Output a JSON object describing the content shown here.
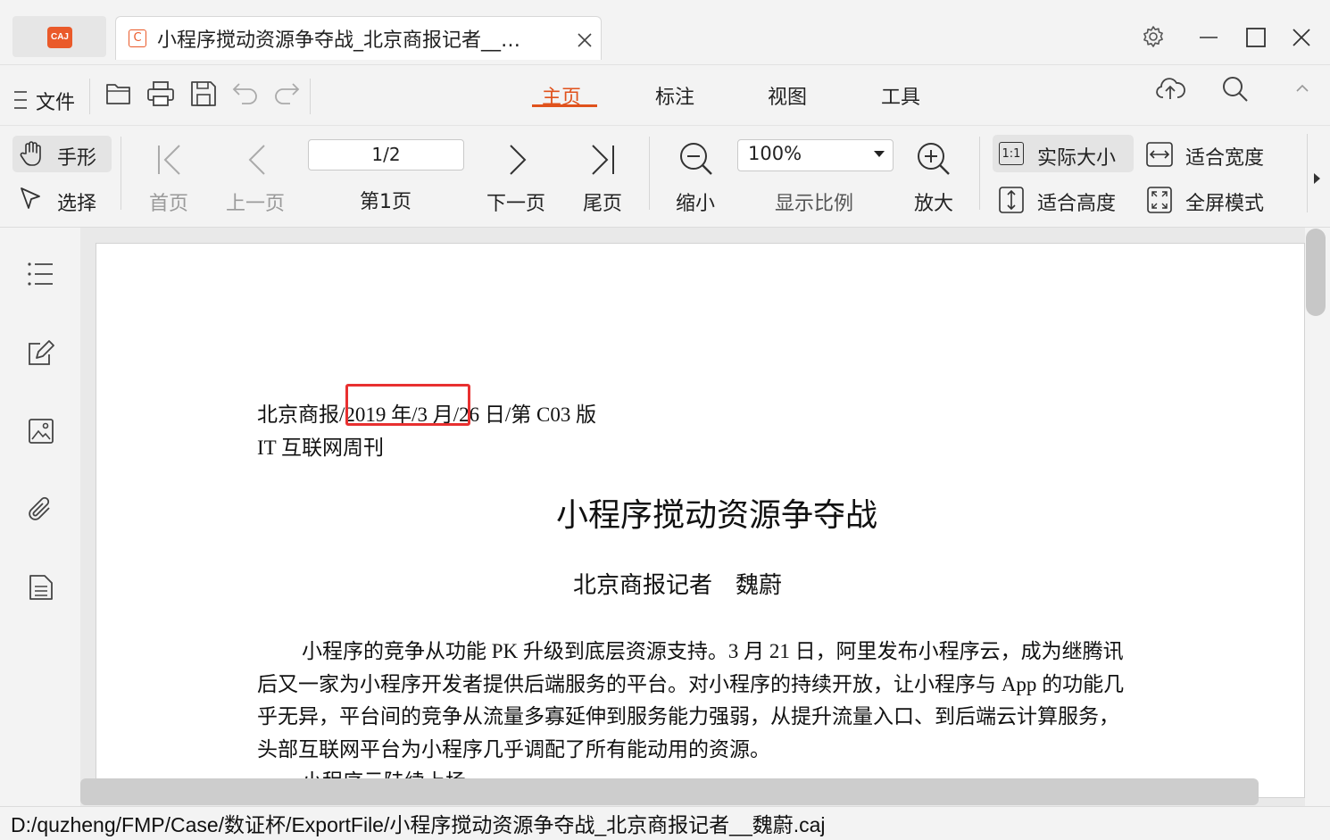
{
  "titlebar": {
    "logo_text": "CAJ",
    "tab_icon_letter": "C",
    "tab_title": "小程序搅动资源争夺战_北京商报记者__…",
    "brand_color": "#ea5a2a"
  },
  "menu": {
    "file_label": "文件",
    "tabs": [
      {
        "label": "主页",
        "active": true
      },
      {
        "label": "标注",
        "active": false
      },
      {
        "label": "视图",
        "active": false
      },
      {
        "label": "工具",
        "active": false
      }
    ],
    "active_color": "#e0521c"
  },
  "toolbar": {
    "hand": "手形",
    "select": "选择",
    "first_page": "首页",
    "prev_page": "上一页",
    "page_value": "1/2",
    "page_label": "第1页",
    "next_page": "下一页",
    "last_page": "尾页",
    "zoom_out": "缩小",
    "zoom_value": "100%",
    "zoom_label": "显示比例",
    "zoom_in": "放大",
    "actual_size_icon_text": "1:1",
    "actual_size": "实际大小",
    "fit_width": "适合宽度",
    "fit_height": "适合高度",
    "fullscreen": "全屏模式"
  },
  "document": {
    "header_line1_a": "北京商报/",
    "header_line1_b": "2019 年/3 月",
    "header_line1_c": "/26 日/第 C03 版",
    "header_line2": "IT 互联网周刊",
    "title": "小程序搅动资源争夺战",
    "byline": "北京商报记者　魏蔚",
    "body_lines": [
      "小程序的竞争从功能 PK 升级到底层资源支持。3 月 21 日，阿里发布小程序云，成为继腾讯",
      "后又一家为小程序开发者提供后端服务的平台。对小程序的持续开放，让小程序与 App 的功能几",
      "乎无异，平台间的竞争从流量多寡延伸到服务能力强弱，从提升流量入口、到后端云计算服务，",
      "头部互联网平台为小程序几乎调配了所有能动用的资源。",
      "小程序云陆续上场"
    ],
    "highlight_color": "#e83030"
  },
  "status": {
    "path": "D:/quzheng/FMP/Case/数证杯/ExportFile/小程序搅动资源争夺战_北京商报记者__魏蔚.caj"
  }
}
